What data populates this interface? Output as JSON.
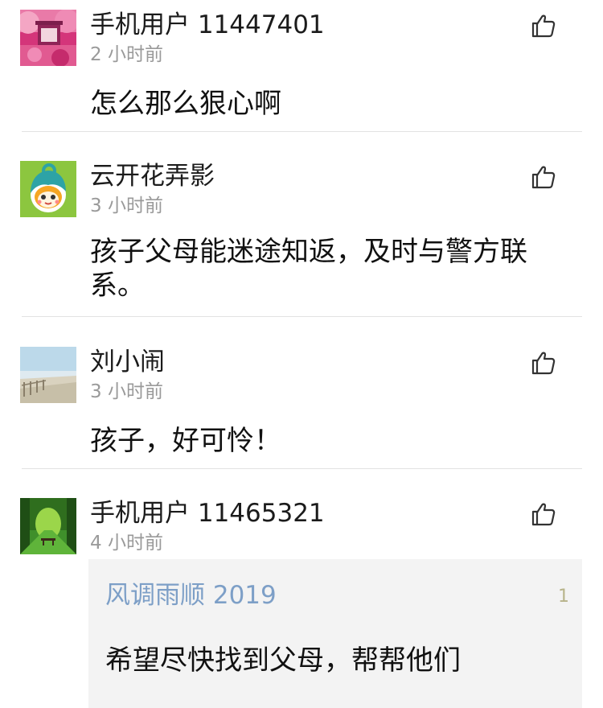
{
  "comments": [
    {
      "username": "手机用户 11447401",
      "time": "2 小时前",
      "text": "怎么那么狠心啊",
      "avatar": "pink-gate-avatar"
    },
    {
      "username": "云开花弄影",
      "time": "3 小时前",
      "text": "孩子父母能迷途知返，及时与警方联系。",
      "avatar": "cartoon-character-avatar"
    },
    {
      "username": "刘小闹",
      "time": "3 小时前",
      "text": "孩子，好可怜！",
      "avatar": "beach-avatar"
    },
    {
      "username": "手机用户 11465321",
      "time": "4 小时前",
      "avatar": "green-forest-avatar",
      "reply": {
        "username": "风调雨顺 2019",
        "count": "1",
        "text": "希望尽快找到父母，帮帮他们"
      }
    }
  ],
  "icons": {
    "like": "thumbs-up-icon"
  },
  "colors": {
    "time": "#9a9a9a",
    "reply_user": "#7d9fc7",
    "reply_background": "#f3f3f3",
    "divider": "#e2e2e2"
  }
}
